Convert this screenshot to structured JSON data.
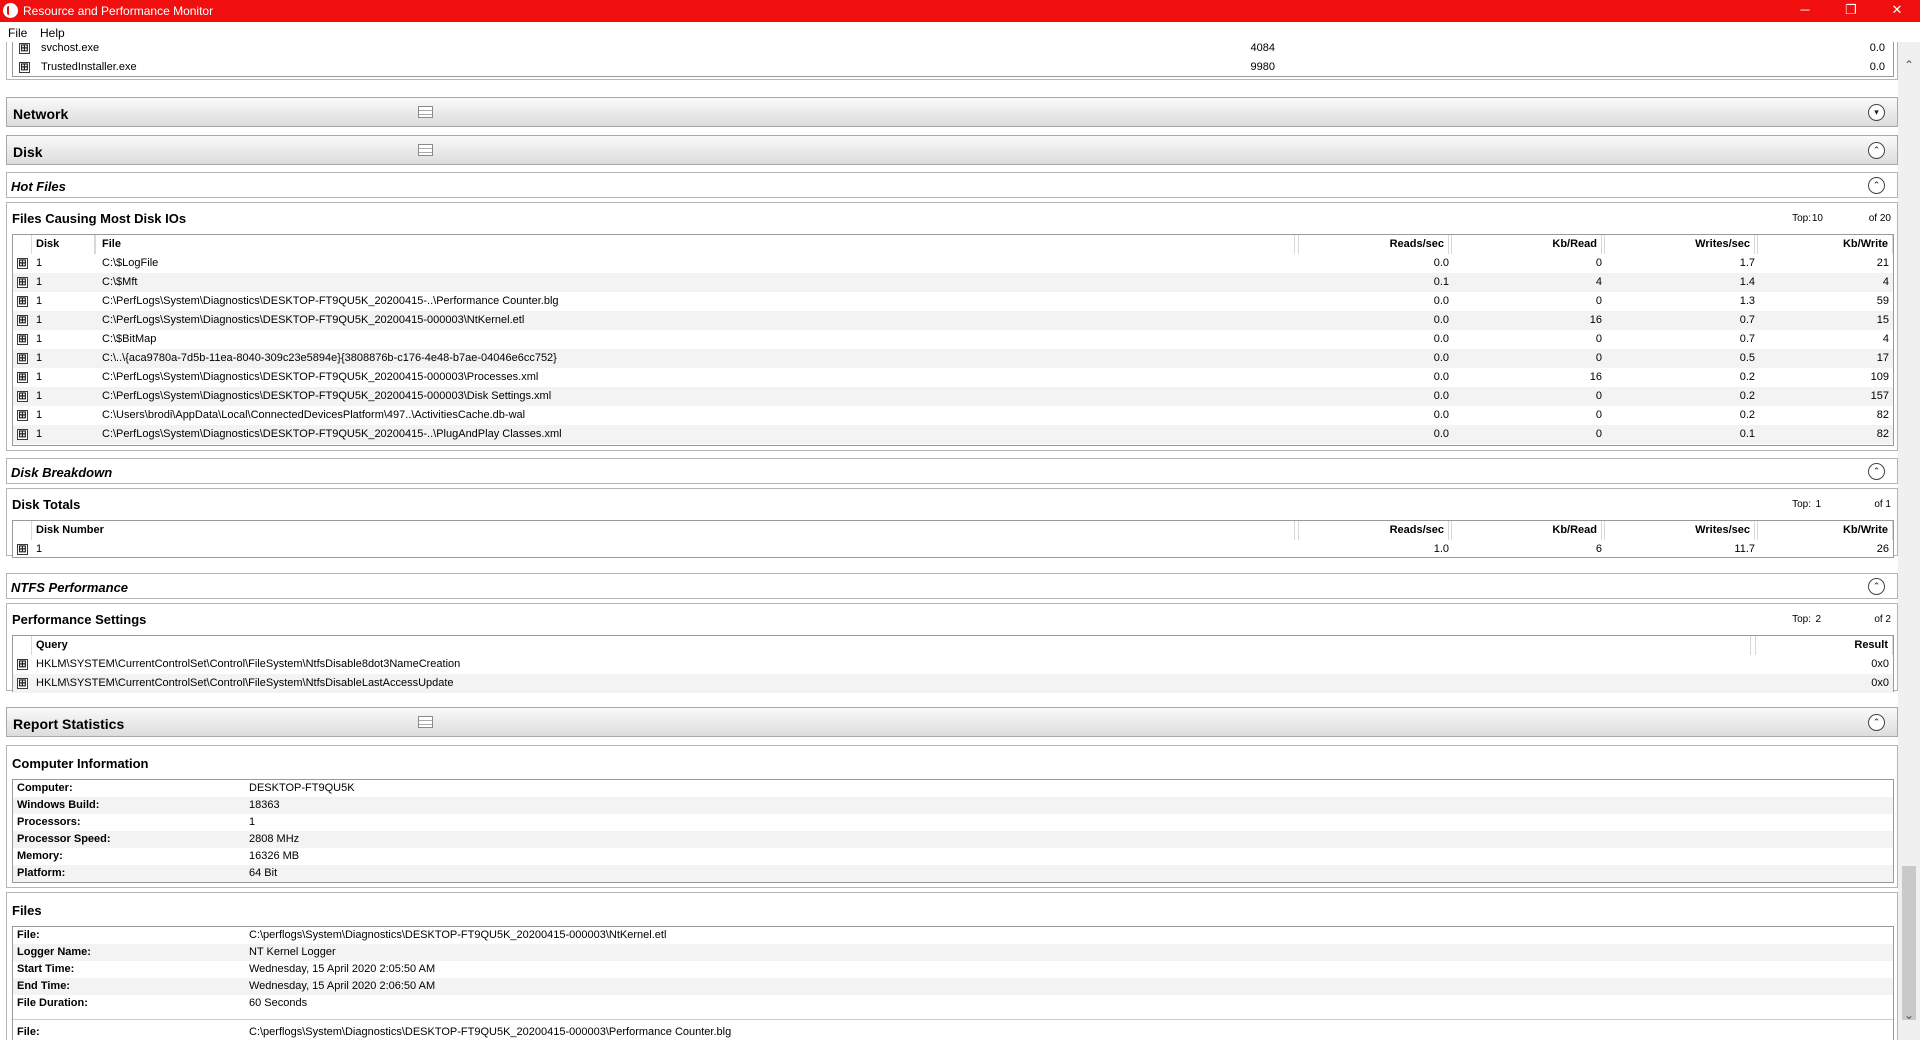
{
  "window": {
    "title": "Resource and Performance Monitor",
    "minimize_glyph": "─",
    "maximize_glyph": "❐",
    "close_glyph": "✕"
  },
  "menu": {
    "file": "File",
    "help": "Help"
  },
  "icons": {
    "expand": "⊞",
    "collapse_up": "⌃",
    "scroll_up": "⌃",
    "scroll_down": "⌄"
  },
  "processes_tail": [
    {
      "name": "svchost.exe",
      "pid": "4084",
      "value": "0.0"
    },
    {
      "name": "TrustedInstaller.exe",
      "pid": "9980",
      "value": "0.0"
    }
  ],
  "sections": {
    "network": "Network",
    "disk": "Disk",
    "hot_files": "Hot Files",
    "disk_breakdown": "Disk Breakdown",
    "ntfs_performance": "NTFS Performance",
    "report_statistics": "Report Statistics"
  },
  "hot_files": {
    "title": "Files Causing Most Disk IOs",
    "top_label": "Top:",
    "top_value": "10",
    "of_label": "of 20",
    "columns": {
      "disk": "Disk",
      "file": "File",
      "reads": "Reads/sec",
      "kbread": "Kb/Read",
      "writes": "Writes/sec",
      "kbwrite": "Kb/Write"
    },
    "rows": [
      {
        "disk": "1",
        "file": "C:\\$LogFile",
        "reads": "0.0",
        "kbread": "0",
        "writes": "1.7",
        "kbwrite": "21"
      },
      {
        "disk": "1",
        "file": "C:\\$Mft",
        "reads": "0.1",
        "kbread": "4",
        "writes": "1.4",
        "kbwrite": "4"
      },
      {
        "disk": "1",
        "file": "C:\\PerfLogs\\System\\Diagnostics\\DESKTOP-FT9QU5K_20200415-..\\Performance Counter.blg",
        "reads": "0.0",
        "kbread": "0",
        "writes": "1.3",
        "kbwrite": "59"
      },
      {
        "disk": "1",
        "file": "C:\\PerfLogs\\System\\Diagnostics\\DESKTOP-FT9QU5K_20200415-000003\\NtKernel.etl",
        "reads": "0.0",
        "kbread": "16",
        "writes": "0.7",
        "kbwrite": "15"
      },
      {
        "disk": "1",
        "file": "C:\\$BitMap",
        "reads": "0.0",
        "kbread": "0",
        "writes": "0.7",
        "kbwrite": "4"
      },
      {
        "disk": "1",
        "file": "C:\\..\\{aca9780a-7d5b-11ea-8040-309c23e5894e}{3808876b-c176-4e48-b7ae-04046e6cc752}",
        "reads": "0.0",
        "kbread": "0",
        "writes": "0.5",
        "kbwrite": "17"
      },
      {
        "disk": "1",
        "file": "C:\\PerfLogs\\System\\Diagnostics\\DESKTOP-FT9QU5K_20200415-000003\\Processes.xml",
        "reads": "0.0",
        "kbread": "16",
        "writes": "0.2",
        "kbwrite": "109"
      },
      {
        "disk": "1",
        "file": "C:\\PerfLogs\\System\\Diagnostics\\DESKTOP-FT9QU5K_20200415-000003\\Disk Settings.xml",
        "reads": "0.0",
        "kbread": "0",
        "writes": "0.2",
        "kbwrite": "157"
      },
      {
        "disk": "1",
        "file": "C:\\Users\\brodi\\AppData\\Local\\ConnectedDevicesPlatform\\497..\\ActivitiesCache.db-wal",
        "reads": "0.0",
        "kbread": "0",
        "writes": "0.2",
        "kbwrite": "82"
      },
      {
        "disk": "1",
        "file": "C:\\PerfLogs\\System\\Diagnostics\\DESKTOP-FT9QU5K_20200415-..\\PlugAndPlay Classes.xml",
        "reads": "0.0",
        "kbread": "0",
        "writes": "0.1",
        "kbwrite": "82"
      }
    ]
  },
  "disk_totals": {
    "title": "Disk Totals",
    "top_label": "Top:",
    "top_value": "1",
    "of_label": "of 1",
    "columns": {
      "disk": "Disk Number",
      "reads": "Reads/sec",
      "kbread": "Kb/Read",
      "writes": "Writes/sec",
      "kbwrite": "Kb/Write"
    },
    "rows": [
      {
        "disk": "1",
        "reads": "1.0",
        "kbread": "6",
        "writes": "11.7",
        "kbwrite": "26"
      }
    ]
  },
  "perf_settings": {
    "title": "Performance Settings",
    "top_label": "Top:",
    "top_value": "2",
    "of_label": "of 2",
    "columns": {
      "query": "Query",
      "result": "Result"
    },
    "rows": [
      {
        "query": "HKLM\\SYSTEM\\CurrentControlSet\\Control\\FileSystem\\NtfsDisable8dot3NameCreation",
        "result": "0x0"
      },
      {
        "query": "HKLM\\SYSTEM\\CurrentControlSet\\Control\\FileSystem\\NtfsDisableLastAccessUpdate",
        "result": "0x0"
      }
    ]
  },
  "computer_info": {
    "title": "Computer Information",
    "rows": [
      {
        "key": "Computer:",
        "value": "DESKTOP-FT9QU5K"
      },
      {
        "key": "Windows Build:",
        "value": "18363"
      },
      {
        "key": "Processors:",
        "value": "1"
      },
      {
        "key": "Processor Speed:",
        "value": "2808 MHz"
      },
      {
        "key": "Memory:",
        "value": "16326 MB"
      },
      {
        "key": "Platform:",
        "value": "64 Bit"
      }
    ]
  },
  "files_info": {
    "title": "Files",
    "rows": [
      {
        "key": "File:",
        "value": "C:\\perflogs\\System\\Diagnostics\\DESKTOP-FT9QU5K_20200415-000003\\NtKernel.etl"
      },
      {
        "key": "Logger Name:",
        "value": "NT Kernel Logger"
      },
      {
        "key": "Start Time:",
        "value": "Wednesday, 15 April 2020 2:05:50 AM"
      },
      {
        "key": "End Time:",
        "value": "Wednesday, 15 April 2020 2:06:50 AM"
      },
      {
        "key": "File Duration:",
        "value": "60 Seconds"
      }
    ],
    "partial_next": {
      "key": "File:",
      "value": "C:\\perflogs\\System\\Diagnostics\\DESKTOP-FT9QU5K_20200415-000003\\Performance Counter.blg"
    }
  }
}
